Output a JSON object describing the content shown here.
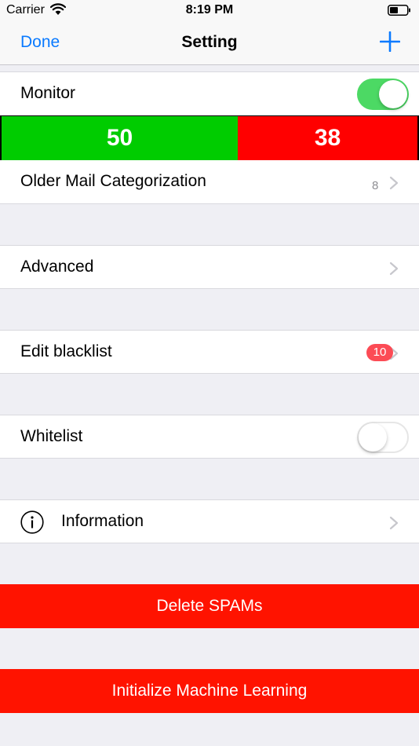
{
  "status_bar": {
    "carrier": "Carrier",
    "time": "8:19 PM"
  },
  "nav": {
    "left_label": "Done",
    "title": "Setting",
    "right_icon": "plus-icon"
  },
  "monitor": {
    "label": "Monitor",
    "enabled": true
  },
  "counters": {
    "good": "50",
    "spam": "38",
    "good_color": "#00cc00",
    "spam_color": "#ff0000"
  },
  "rows": {
    "older_mail": {
      "label": "Older Mail Categorization",
      "detail": "8"
    },
    "advanced": {
      "label": "Advanced"
    },
    "blacklist": {
      "label": "Edit blacklist",
      "badge": "10"
    },
    "whitelist": {
      "label": "Whitelist",
      "enabled": false
    },
    "information": {
      "label": "Information",
      "icon": "info-icon"
    }
  },
  "buttons": {
    "delete_spams": "Delete SPAMs",
    "init_ml": "Initialize Machine Learning"
  },
  "colors": {
    "accent": "#0a7aff",
    "switch_on": "#4cd964",
    "destructive": "#ff1300",
    "badge": "#fc4b55"
  }
}
